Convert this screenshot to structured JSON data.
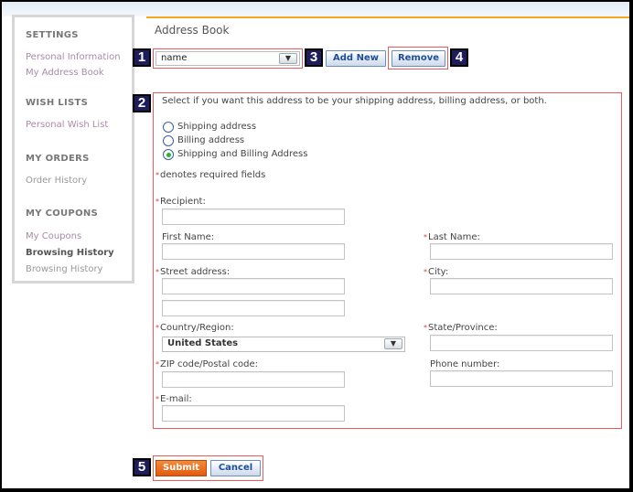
{
  "sidebar": {
    "sections": [
      {
        "heading": "SETTINGS",
        "items": [
          "Personal Information",
          "My Address Book"
        ]
      },
      {
        "heading": "WISH LISTS",
        "items": [
          "Personal Wish List"
        ]
      },
      {
        "heading": "MY ORDERS",
        "items": [
          "Order History"
        ]
      },
      {
        "heading": "MY COUPONS",
        "items": [
          "My Coupons",
          "Browsing History",
          "Browsing History"
        ]
      }
    ]
  },
  "page": {
    "title": "Address Book",
    "address_select": {
      "value": "name"
    },
    "add_new_label": "Add New",
    "remove_label": "Remove"
  },
  "callouts": [
    "1",
    "2",
    "3",
    "4",
    "5"
  ],
  "form": {
    "instruction": "Select if you want this address to be your shipping address, billing address, or both.",
    "address_type_options": [
      {
        "label": "Shipping address",
        "selected": false
      },
      {
        "label": "Billing address",
        "selected": false
      },
      {
        "label": "Shipping and Billing Address",
        "selected": true
      }
    ],
    "required_note": "denotes required fields",
    "required_mark": "*",
    "fields": {
      "recipient": {
        "label": "Recipient:",
        "required": true,
        "value": ""
      },
      "first_name": {
        "label": "First Name:",
        "required": false,
        "value": ""
      },
      "last_name": {
        "label": "Last Name:",
        "required": true,
        "value": ""
      },
      "street": {
        "label": "Street address:",
        "required": true,
        "value": "",
        "value2": ""
      },
      "city": {
        "label": "City:",
        "required": true,
        "value": ""
      },
      "country": {
        "label": "Country/Region:",
        "required": true,
        "value": "United States"
      },
      "state": {
        "label": "State/Province:",
        "required": true,
        "value": ""
      },
      "zip": {
        "label": "ZIP code/Postal code:",
        "required": true,
        "value": ""
      },
      "phone": {
        "label": "Phone number:",
        "required": false,
        "value": ""
      },
      "email": {
        "label": "E-mail:",
        "required": true,
        "value": ""
      }
    },
    "submit_label": "Submit",
    "cancel_label": "Cancel"
  },
  "colors": {
    "accent_orange": "#f5a623",
    "callout_box": "#ee5a5a",
    "badge_bg": "#1d1d5e",
    "submit_bg": "#e35a0c",
    "link_blue": "#1f4f9a"
  }
}
